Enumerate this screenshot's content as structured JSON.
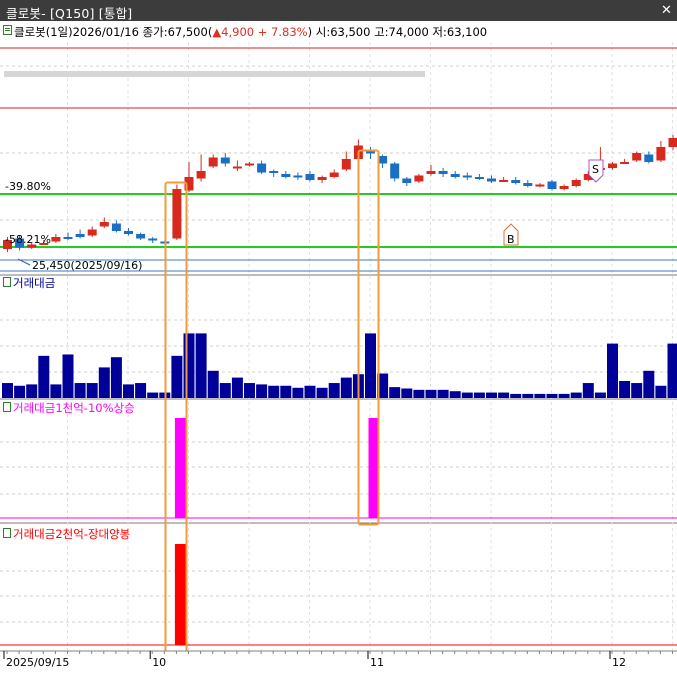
{
  "window": {
    "title": "클로봇- [Q150] [통합]",
    "close_glyph": "✕"
  },
  "info": {
    "prefix": "클로봇(1일)2026/01/16 종가:67,500(",
    "change_arrow": "▲",
    "change_value": "4,900",
    "change_pct": "+ 7.83%",
    "suffix": ") 시:63,500 고:74,000 저:63,100"
  },
  "price_pane": {
    "levels": [
      {
        "label": "-39.80%",
        "color": "#22cc22"
      },
      {
        "label": "-58.21%",
        "color": "#22cc22"
      }
    ],
    "low_marker": "25,450(2025/09/16)",
    "signals": [
      {
        "label": "S",
        "color": "#b050c8"
      },
      {
        "label": "B",
        "color": "#e07030"
      }
    ],
    "candles": [
      {
        "o": 0.4,
        "c": 0.46,
        "h": 0.48,
        "l": 0.38
      },
      {
        "o": 0.47,
        "c": 0.41,
        "h": 0.49,
        "l": 0.39
      },
      {
        "o": 0.41,
        "c": 0.43,
        "h": 0.44,
        "l": 0.4
      },
      {
        "o": 0.44,
        "c": 0.44,
        "h": 0.46,
        "l": 0.43
      },
      {
        "o": 0.45,
        "c": 0.48,
        "h": 0.5,
        "l": 0.44
      },
      {
        "o": 0.48,
        "c": 0.47,
        "h": 0.51,
        "l": 0.46
      },
      {
        "o": 0.5,
        "c": 0.48,
        "h": 0.53,
        "l": 0.47
      },
      {
        "o": 0.49,
        "c": 0.53,
        "h": 0.55,
        "l": 0.48
      },
      {
        "o": 0.55,
        "c": 0.58,
        "h": 0.61,
        "l": 0.54
      },
      {
        "o": 0.57,
        "c": 0.52,
        "h": 0.59,
        "l": 0.51
      },
      {
        "o": 0.52,
        "c": 0.5,
        "h": 0.54,
        "l": 0.49
      },
      {
        "o": 0.5,
        "c": 0.47,
        "h": 0.51,
        "l": 0.46
      },
      {
        "o": 0.47,
        "c": 0.46,
        "h": 0.48,
        "l": 0.44
      },
      {
        "o": 0.45,
        "c": 0.44,
        "h": 0.46,
        "l": 0.43
      },
      {
        "o": 0.47,
        "c": 0.8,
        "h": 0.83,
        "l": 0.46
      },
      {
        "o": 0.79,
        "c": 0.88,
        "h": 0.98,
        "l": 0.78
      },
      {
        "o": 0.87,
        "c": 0.92,
        "h": 1.03,
        "l": 0.85
      },
      {
        "o": 0.95,
        "c": 1.01,
        "h": 1.03,
        "l": 0.94
      },
      {
        "o": 1.01,
        "c": 0.97,
        "h": 1.04,
        "l": 0.95
      },
      {
        "o": 0.94,
        "c": 0.95,
        "h": 0.99,
        "l": 0.92
      },
      {
        "o": 0.97,
        "c": 0.97,
        "h": 0.98,
        "l": 0.95
      },
      {
        "o": 0.97,
        "c": 0.91,
        "h": 0.99,
        "l": 0.9
      },
      {
        "o": 0.92,
        "c": 0.91,
        "h": 0.93,
        "l": 0.88
      },
      {
        "o": 0.9,
        "c": 0.88,
        "h": 0.92,
        "l": 0.87
      },
      {
        "o": 0.89,
        "c": 0.88,
        "h": 0.91,
        "l": 0.86
      },
      {
        "o": 0.9,
        "c": 0.86,
        "h": 0.92,
        "l": 0.85
      },
      {
        "o": 0.86,
        "c": 0.88,
        "h": 0.89,
        "l": 0.84
      },
      {
        "o": 0.88,
        "c": 0.91,
        "h": 0.93,
        "l": 0.87
      },
      {
        "o": 0.93,
        "c": 1.0,
        "h": 1.05,
        "l": 0.92
      },
      {
        "o": 1.0,
        "c": 1.09,
        "h": 1.13,
        "l": 0.97
      },
      {
        "o": 1.05,
        "c": 1.04,
        "h": 1.08,
        "l": 1.0
      },
      {
        "o": 1.02,
        "c": 0.97,
        "h": 1.03,
        "l": 0.94
      },
      {
        "o": 0.97,
        "c": 0.87,
        "h": 0.98,
        "l": 0.85
      },
      {
        "o": 0.87,
        "c": 0.84,
        "h": 0.88,
        "l": 0.82
      },
      {
        "o": 0.85,
        "c": 0.89,
        "h": 0.9,
        "l": 0.84
      },
      {
        "o": 0.9,
        "c": 0.92,
        "h": 0.96,
        "l": 0.89
      },
      {
        "o": 0.92,
        "c": 0.9,
        "h": 0.94,
        "l": 0.88
      },
      {
        "o": 0.9,
        "c": 0.88,
        "h": 0.92,
        "l": 0.87
      },
      {
        "o": 0.89,
        "c": 0.88,
        "h": 0.91,
        "l": 0.86
      },
      {
        "o": 0.88,
        "c": 0.87,
        "h": 0.9,
        "l": 0.86
      },
      {
        "o": 0.87,
        "c": 0.85,
        "h": 0.89,
        "l": 0.84
      },
      {
        "o": 0.86,
        "c": 0.86,
        "h": 0.88,
        "l": 0.85
      },
      {
        "o": 0.86,
        "c": 0.84,
        "h": 0.88,
        "l": 0.83
      },
      {
        "o": 0.84,
        "c": 0.82,
        "h": 0.86,
        "l": 0.81
      },
      {
        "o": 0.82,
        "c": 0.83,
        "h": 0.84,
        "l": 0.81
      },
      {
        "o": 0.85,
        "c": 0.8,
        "h": 0.86,
        "l": 0.79
      },
      {
        "o": 0.8,
        "c": 0.82,
        "h": 0.83,
        "l": 0.79
      },
      {
        "o": 0.82,
        "c": 0.86,
        "h": 0.87,
        "l": 0.81
      },
      {
        "o": 0.86,
        "c": 0.9,
        "h": 0.92,
        "l": 0.85
      },
      {
        "o": 0.93,
        "c": 0.94,
        "h": 1.08,
        "l": 0.92
      },
      {
        "o": 0.94,
        "c": 0.97,
        "h": 0.98,
        "l": 0.93
      },
      {
        "o": 0.98,
        "c": 0.98,
        "h": 1.0,
        "l": 0.97
      },
      {
        "o": 0.99,
        "c": 1.04,
        "h": 1.05,
        "l": 0.98
      },
      {
        "o": 1.03,
        "c": 0.98,
        "h": 1.05,
        "l": 0.97
      },
      {
        "o": 0.99,
        "c": 1.08,
        "h": 1.12,
        "l": 0.98
      },
      {
        "o": 1.08,
        "c": 1.14,
        "h": 1.16,
        "l": 1.06
      }
    ]
  },
  "volume_pane": {
    "label": "거래대금",
    "color": "#000099",
    "values": [
      0.22,
      0.18,
      0.2,
      0.62,
      0.2,
      0.64,
      0.22,
      0.22,
      0.45,
      0.6,
      0.2,
      0.22,
      0.08,
      0.08,
      0.62,
      0.95,
      0.95,
      0.4,
      0.22,
      0.3,
      0.22,
      0.2,
      0.18,
      0.18,
      0.15,
      0.18,
      0.15,
      0.22,
      0.3,
      0.35,
      0.95,
      0.36,
      0.16,
      0.14,
      0.12,
      0.12,
      0.12,
      0.1,
      0.08,
      0.08,
      0.08,
      0.08,
      0.06,
      0.06,
      0.06,
      0.06,
      0.06,
      0.08,
      0.22,
      0.08,
      0.8,
      0.25,
      0.22,
      0.4,
      0.18,
      0.8
    ]
  },
  "signal1_pane": {
    "label": "거래대금1천억-10%상승",
    "color": "#ff00ff",
    "active_bars": [
      14,
      30
    ]
  },
  "signal2_pane": {
    "label": "거래대금2천억-장대양봉",
    "color": "#ff0000",
    "active_bars": [
      14
    ]
  },
  "x_axis": {
    "labels": [
      {
        "text": "2025/09/15",
        "bar": 0
      },
      {
        "text": "10",
        "bar": 12
      },
      {
        "text": "11",
        "bar": 30
      },
      {
        "text": "12",
        "bar": 50
      }
    ]
  },
  "highlight_color": "#f39a3a",
  "up_color": "#d62a1e",
  "down_color": "#1a6fc4",
  "level_line_color": "#d42020"
}
